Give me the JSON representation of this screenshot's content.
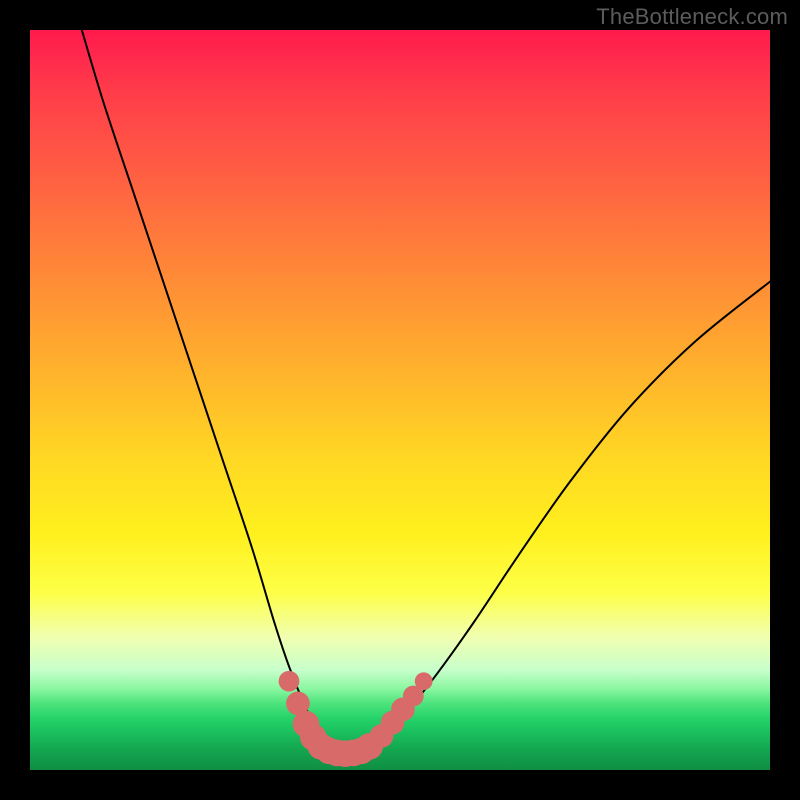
{
  "watermark": "TheBottleneck.com",
  "chart_data": {
    "type": "line",
    "title": "",
    "xlabel": "",
    "ylabel": "",
    "xlim": [
      0,
      100
    ],
    "ylim": [
      0,
      100
    ],
    "series": [
      {
        "name": "bottleneck-curve",
        "x": [
          7,
          10,
          14,
          18,
          22,
          26,
          30,
          33,
          35,
          37,
          38.5,
          40,
          42,
          44,
          46,
          48,
          51,
          55,
          60,
          66,
          73,
          81,
          90,
          100
        ],
        "values": [
          100,
          90,
          78,
          66,
          54,
          42,
          30,
          20,
          14,
          9,
          6,
          4,
          3,
          3,
          3.5,
          5,
          8,
          13,
          20,
          29,
          39,
          49,
          58,
          66
        ]
      }
    ],
    "markers": {
      "name": "highlight-dots",
      "color": "#d86a6a",
      "points": [
        {
          "x": 35.0,
          "y": 12.0,
          "r": 1.4
        },
        {
          "x": 36.2,
          "y": 9.0,
          "r": 1.6
        },
        {
          "x": 37.3,
          "y": 6.2,
          "r": 1.8
        },
        {
          "x": 38.3,
          "y": 4.4,
          "r": 1.8
        },
        {
          "x": 39.3,
          "y": 3.2,
          "r": 1.8
        },
        {
          "x": 40.4,
          "y": 2.6,
          "r": 1.8
        },
        {
          "x": 41.5,
          "y": 2.3,
          "r": 1.8
        },
        {
          "x": 42.6,
          "y": 2.2,
          "r": 1.8
        },
        {
          "x": 43.7,
          "y": 2.3,
          "r": 1.8
        },
        {
          "x": 44.8,
          "y": 2.6,
          "r": 1.8
        },
        {
          "x": 45.9,
          "y": 3.2,
          "r": 1.8
        },
        {
          "x": 47.5,
          "y": 4.6,
          "r": 1.6
        },
        {
          "x": 49.0,
          "y": 6.4,
          "r": 1.6
        },
        {
          "x": 50.4,
          "y": 8.2,
          "r": 1.6
        },
        {
          "x": 51.8,
          "y": 10.0,
          "r": 1.4
        },
        {
          "x": 53.2,
          "y": 12.0,
          "r": 1.2
        }
      ]
    }
  }
}
